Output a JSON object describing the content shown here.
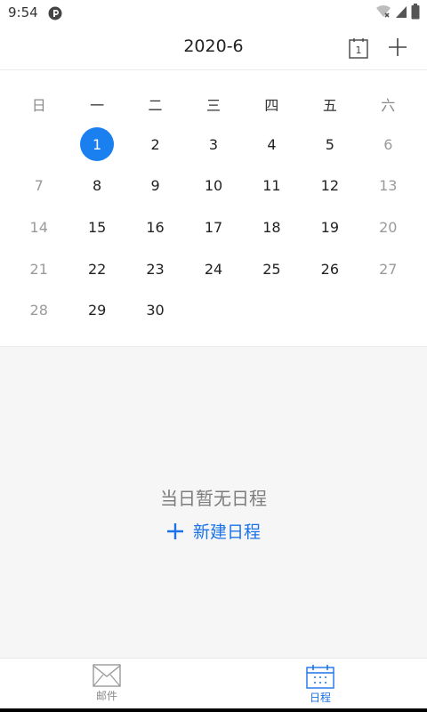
{
  "status_bar": {
    "time": "9:54",
    "icons": [
      "app-notification-icon",
      "wifi-icon",
      "signal-icon",
      "battery-icon"
    ]
  },
  "header": {
    "title": "2020-6",
    "today_icon_text": "1",
    "actions": [
      "today-icon",
      "plus-icon"
    ]
  },
  "calendar": {
    "weekdays": [
      "日",
      "一",
      "二",
      "三",
      "四",
      "五",
      "六"
    ],
    "weeks": [
      [
        "",
        "1",
        "2",
        "3",
        "4",
        "5",
        "6"
      ],
      [
        "7",
        "8",
        "9",
        "10",
        "11",
        "12",
        "13"
      ],
      [
        "14",
        "15",
        "16",
        "17",
        "18",
        "19",
        "20"
      ],
      [
        "21",
        "22",
        "23",
        "24",
        "25",
        "26",
        "27"
      ],
      [
        "28",
        "29",
        "30",
        "",
        "",
        "",
        ""
      ]
    ],
    "selected_day": "1",
    "accent_color": "#1a80f0"
  },
  "schedule": {
    "empty_text": "当日暂无日程",
    "new_event_label": "新建日程"
  },
  "bottom_nav": {
    "items": [
      {
        "label": "邮件",
        "icon": "mail-icon",
        "active": false
      },
      {
        "label": "日程",
        "icon": "calendar-icon",
        "active": true
      }
    ]
  }
}
